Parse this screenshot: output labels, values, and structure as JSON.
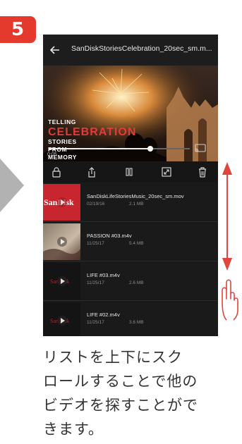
{
  "step": {
    "number": "5"
  },
  "app": {
    "title": "SanDiskStoriesCelebration_20sec_sm.m...",
    "video": {
      "overlay_small_top": "TELLING",
      "overlay_big": "CELEBRATION",
      "overlay_small_1": "STORIES",
      "overlay_small_2": "FROM",
      "overlay_small_3": "MEMORY",
      "elapsed": "0:05",
      "progress_fraction": 0.72
    },
    "controls": [
      "lock-icon",
      "share-icon",
      "pause-icon",
      "fullscreen-icon",
      "trash-icon"
    ],
    "list": [
      {
        "thumb_label": "SanDisk",
        "title": "SanDiskLifeStoriesMusic_20sec_sm.mov",
        "date": "02/19/16",
        "size": "2.1 MB"
      },
      {
        "thumb_label": "",
        "title": "PASSION   #03.m4v",
        "date": "11/25/17",
        "size": "5.4 MB"
      },
      {
        "thumb_label": "",
        "title": "LIFE   #03.m4v",
        "date": "11/25/17",
        "size": "2.6 MB"
      },
      {
        "thumb_label": "",
        "title": "LIFE   #02.m4v",
        "date": "11/25/17",
        "size": "3.6 MB"
      }
    ]
  },
  "caption": {
    "line1": "リストを上下にスク",
    "line2": "ロールすることで他の",
    "line3": "ビデオを探すことがで",
    "line4": "きます。"
  },
  "colors": {
    "accent_red": "#e43a2d",
    "scroll_arrow_red": "#e0443a",
    "nav_arrow_gray": "#b2b2b2"
  }
}
